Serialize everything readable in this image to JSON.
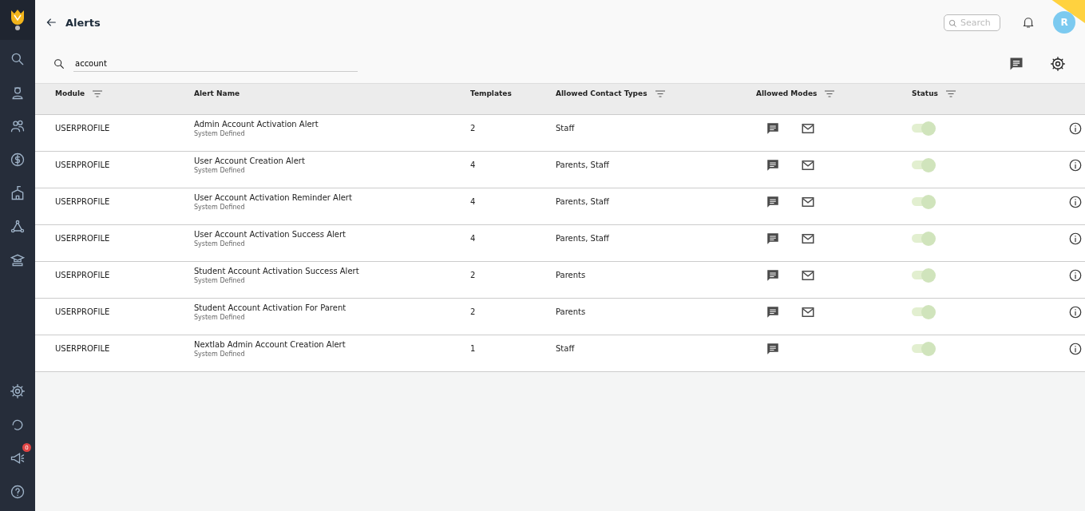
{
  "header": {
    "title": "Alerts",
    "search": {
      "placeholder": "Search"
    },
    "avatar": "R"
  },
  "sidebar": {
    "notification_badge": "0"
  },
  "filter": {
    "value": "account"
  },
  "table": {
    "columns": [
      {
        "label": "Module",
        "filter": true
      },
      {
        "label": "Alert Name",
        "filter": false
      },
      {
        "label": "Templates",
        "filter": false
      },
      {
        "label": "Allowed Contact Types",
        "filter": true
      },
      {
        "label": "Allowed Modes",
        "filter": true
      },
      {
        "label": "Status",
        "filter": true
      }
    ],
    "rows": [
      {
        "module": "USERPROFILE",
        "name": "Admin Account Activation Alert",
        "type": "System Defined",
        "templates": "2",
        "contacts": "Staff",
        "sms": true,
        "email": true,
        "on": true,
        "disabled": true
      },
      {
        "module": "USERPROFILE",
        "name": "User Account Creation Alert",
        "type": "System Defined",
        "templates": "4",
        "contacts": "Parents, Staff",
        "sms": true,
        "email": true,
        "on": true,
        "disabled": true
      },
      {
        "module": "USERPROFILE",
        "name": "User Account Activation Reminder Alert",
        "type": "System Defined",
        "templates": "4",
        "contacts": "Parents, Staff",
        "sms": true,
        "email": true,
        "on": true,
        "disabled": true
      },
      {
        "module": "USERPROFILE",
        "name": "User Account Activation Success Alert",
        "type": "System Defined",
        "templates": "4",
        "contacts": "Parents, Staff",
        "sms": true,
        "email": true,
        "on": true,
        "disabled": true
      },
      {
        "module": "USERPROFILE",
        "name": "Student Account Activation Success Alert",
        "type": "System Defined",
        "templates": "2",
        "contacts": "Parents",
        "sms": true,
        "email": true,
        "on": true,
        "disabled": true
      },
      {
        "module": "USERPROFILE",
        "name": "Student Account Activation For Parent",
        "type": "System Defined",
        "templates": "2",
        "contacts": "Parents",
        "sms": true,
        "email": true,
        "on": true,
        "disabled": true
      },
      {
        "module": "USERPROFILE",
        "name": "Nextlab Admin Account Creation Alert",
        "type": "System Defined",
        "templates": "1",
        "contacts": "Staff",
        "sms": true,
        "email": false,
        "on": true,
        "disabled": true
      }
    ]
  }
}
